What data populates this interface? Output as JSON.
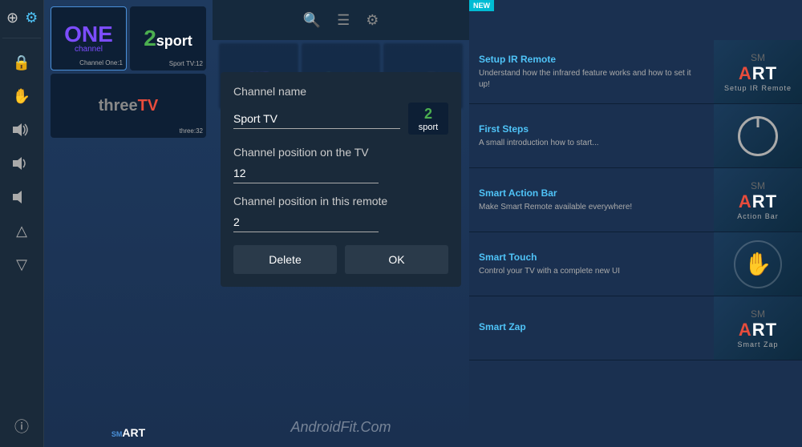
{
  "sidebar": {
    "top_icons": [
      {
        "name": "plus-icon",
        "symbol": "+"
      },
      {
        "name": "settings-icon",
        "symbol": "⚙"
      },
      {
        "name": "exit-icon",
        "symbol": "⊡"
      },
      {
        "name": "power-icon",
        "symbol": "⏻"
      }
    ],
    "nav_icons": [
      {
        "name": "lock-icon",
        "symbol": "🔒"
      },
      {
        "name": "hand-icon",
        "symbol": "✋"
      },
      {
        "name": "volume-high-icon",
        "symbol": "🔊"
      },
      {
        "name": "volume-mid-icon",
        "symbol": "🔉"
      },
      {
        "name": "volume-low-icon",
        "symbol": "🔈"
      },
      {
        "name": "triangle-up-icon",
        "symbol": "△"
      },
      {
        "name": "triangle-down-icon",
        "symbol": "▽"
      }
    ],
    "bottom_icons": [
      {
        "name": "info-icon",
        "symbol": "ⓘ"
      }
    ]
  },
  "channels": [
    {
      "id": 1,
      "name": "ONE channel",
      "label": "Channel One:1",
      "line1": "ONE",
      "line2": "channel"
    },
    {
      "id": 2,
      "name": "2sport",
      "label": "Sport TV:12",
      "number": "2",
      "text": "sport"
    },
    {
      "id": 3,
      "name": "threeTV",
      "label": "three:32",
      "three": "three",
      "tv": "TV"
    }
  ],
  "dialog": {
    "title_channel_name": "Channel name",
    "channel_name_value": "Sport TV",
    "title_channel_position_tv": "Channel position on the TV",
    "channel_position_tv_value": "12",
    "title_channel_position_remote": "Channel position in this remote",
    "channel_position_remote_value": "2",
    "badge_number": "2",
    "badge_text": "sport",
    "delete_button": "Delete",
    "ok_button": "OK"
  },
  "watermark": "AndroidFit.Com",
  "right_panel": {
    "new_badge": "NEW",
    "items": [
      {
        "title": "Setup IR Remote",
        "description": "Understand how the infrared feature works and how to set it up!",
        "visual_type": "smart-logo",
        "logo_sm": "SM",
        "logo_big_left": "ART",
        "logo_sub": "Setup IR Remote"
      },
      {
        "title": "First Steps",
        "description": "A small introduction how to start...",
        "visual_type": "power-circle"
      },
      {
        "title": "Smart Action Bar",
        "description": "Make Smart Remote available everywhere!",
        "visual_type": "smart-logo",
        "logo_sm": "SM",
        "logo_big_left": "ART",
        "logo_sub": "Action Bar"
      },
      {
        "title": "Smart Touch",
        "description": "Control your TV with a complete new UI",
        "visual_type": "hand-circle"
      },
      {
        "title": "Smart Zap",
        "description": "",
        "visual_type": "smart-logo",
        "logo_sm": "SM",
        "logo_big_left": "ART",
        "logo_sub": "Smart Zap"
      }
    ]
  }
}
